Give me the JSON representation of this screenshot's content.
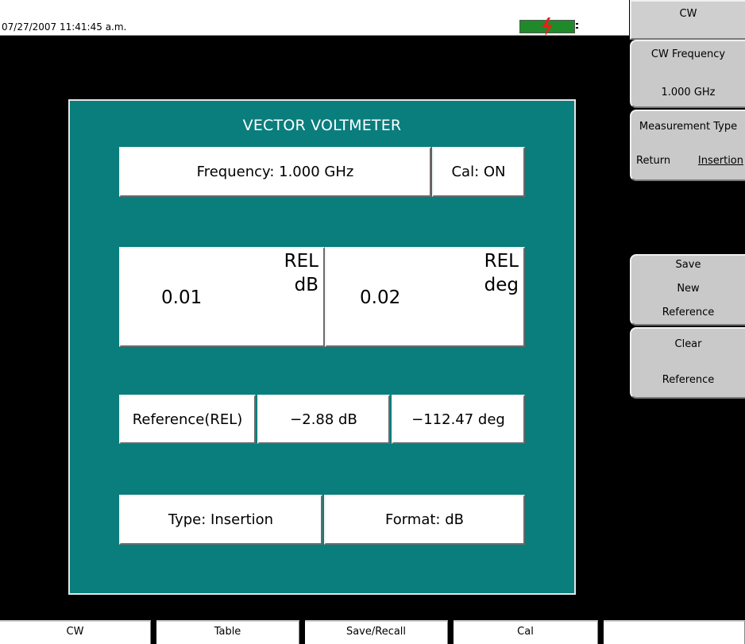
{
  "status_bar": {
    "timestamp": "07/27/2007 11:41:45 a.m.",
    "battery_icon": "battery-charging-icon",
    "battery_color": "#1f8a2a",
    "bolt_color": "#e0241b"
  },
  "panel": {
    "title": "VECTOR VOLTMETER",
    "background": "#0a7d7d",
    "frequency": "Frequency: 1.000 GHz",
    "cal": "Cal: ON",
    "magnitude": {
      "value": "0.01",
      "rel": "REL",
      "unit": "dB"
    },
    "phase": {
      "value": "0.02",
      "rel": "REL",
      "unit": "deg"
    },
    "reference": {
      "label": "Reference(REL)",
      "magnitude": "−2.88 dB",
      "phase": "−112.47 deg"
    },
    "type": "Type: Insertion",
    "format": "Format: dB"
  },
  "softkeys": {
    "menu_title": "CW",
    "cw_frequency": {
      "label": "CW Frequency",
      "value": "1.000 GHz"
    },
    "measurement_type": {
      "label": "Measurement Type",
      "option_return": "Return",
      "option_insertion": "Insertion"
    },
    "save_reference": {
      "line1": "Save",
      "line2": "New",
      "line3": "Reference"
    },
    "clear_reference": {
      "line1": "Clear",
      "line2": "Reference"
    }
  },
  "bottom_tabs": [
    "CW",
    "Table",
    "Save/Recall",
    "Cal",
    ""
  ]
}
